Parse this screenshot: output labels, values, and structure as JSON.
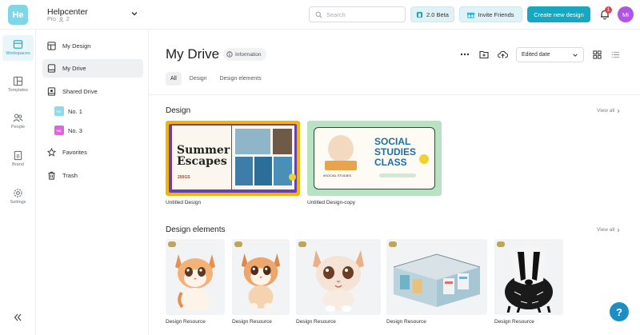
{
  "workspace": {
    "logo": "He",
    "name": "Helpcenter",
    "plan": "Pro",
    "members": "2"
  },
  "search": {
    "placeholder": "Search"
  },
  "header": {
    "beta_label": "2.0 Beta",
    "invite_label": "Invite Friends",
    "create_label": "Create new design",
    "notif_count": "1",
    "avatar_initials": "Mi"
  },
  "rail": {
    "workspaces": "Workspaces",
    "templates": "Templates",
    "people": "People",
    "brand": "Brand",
    "settings": "Settings"
  },
  "sidebar": {
    "my_design": "My Design",
    "my_drive": "My Drive",
    "shared_drive": "Shared Drive",
    "no1": {
      "chip": "No.",
      "label": "No. 1",
      "color": "#8fd9ea"
    },
    "no3": {
      "chip": "No.",
      "label": "No. 3",
      "color": "#d66ad6"
    },
    "favorites": "Favorites",
    "trash": "Trash"
  },
  "main": {
    "title": "My Drive",
    "info_label": "Information",
    "sort_label": "Edited date",
    "tabs": [
      "All",
      "Design",
      "Design elements"
    ],
    "design_section": "Design",
    "elements_section": "Design elements",
    "view_all": "View all"
  },
  "designs": [
    {
      "label": "Untitled Design",
      "thumb_title_1": "Summer",
      "thumb_title_2": "Escapes",
      "thumb_tag": "200GS"
    },
    {
      "label": "Untitled Design-copy",
      "thumb_title_1": "SOCIAL",
      "thumb_title_2": "STUDIES",
      "thumb_title_3": "CLASS",
      "thumb_caption": "#SOCIAL STUDIES"
    }
  ],
  "elements": [
    {
      "label": "Design Resource",
      "icon": "kitten-icon"
    },
    {
      "label": "Design Resource",
      "icon": "kitten-icon"
    },
    {
      "label": "Design Resource",
      "icon": "kitten-icon"
    },
    {
      "label": "Design Resource",
      "icon": "store-icon"
    },
    {
      "label": "Design Resource",
      "icon": "badger-icon"
    }
  ],
  "colors": {
    "accent": "#16a8c2",
    "avatar": "#b154e0",
    "badge": "#e04848"
  }
}
